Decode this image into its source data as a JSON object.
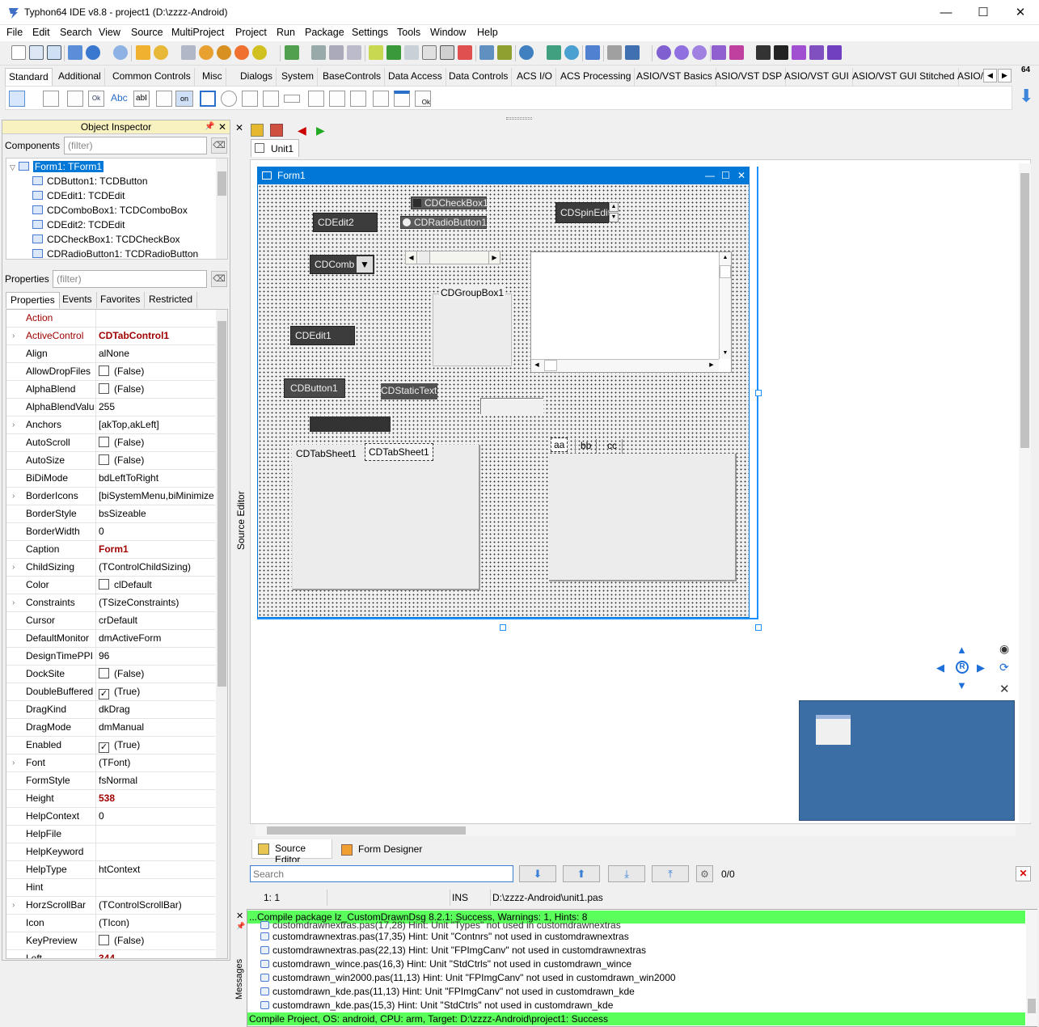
{
  "window": {
    "title": "Typhon64 IDE v8.8 - project1 (D:\\zzzz-Android)",
    "controls": [
      "—",
      "☐",
      "✕"
    ]
  },
  "menu": [
    "File",
    "Edit",
    "Search",
    "View",
    "Source",
    "MultiProject",
    "Project",
    "Run",
    "Package",
    "Settings",
    "Tools",
    "Window",
    "Help"
  ],
  "palette": {
    "tabs": [
      "Standard",
      "Additional",
      "Common Controls",
      "Misc",
      "Dialogs",
      "System",
      "BaseControls",
      "Data Access",
      "Data Controls",
      "ACS I/O",
      "ACS Processing",
      "ASIO/VST Basics",
      "ASIO/VST DSP",
      "ASIO/VST GUI",
      "ASIO/VST GUI Stitched",
      "ASIO/"
    ],
    "active": "Standard",
    "zoom": "64"
  },
  "object_inspector": {
    "title": "Object Inspector",
    "components_label": "Components",
    "filter_placeholder": "(filter)",
    "tree": [
      "Form1: TForm1",
      "CDButton1: TCDButton",
      "CDEdit1: TCDEdit",
      "CDComboBox1: TCDComboBox",
      "CDEdit2: TCDEdit",
      "CDCheckBox1: TCDCheckBox",
      "CDRadioButton1: TCDRadioButton"
    ],
    "properties_label": "Properties",
    "tabs": [
      "Properties",
      "Events",
      "Favorites",
      "Restricted"
    ],
    "rows": [
      {
        "name": "Action",
        "value": ""
      },
      {
        "name": "ActiveControl",
        "value": "CDTabControl1"
      },
      {
        "name": "Align",
        "value": "alNone"
      },
      {
        "name": "AllowDropFiles",
        "value": "(False)"
      },
      {
        "name": "AlphaBlend",
        "value": "(False)"
      },
      {
        "name": "AlphaBlendValu",
        "value": "255"
      },
      {
        "name": "Anchors",
        "value": "[akTop,akLeft]"
      },
      {
        "name": "AutoScroll",
        "value": "(False)"
      },
      {
        "name": "AutoSize",
        "value": "(False)"
      },
      {
        "name": "BiDiMode",
        "value": "bdLeftToRight"
      },
      {
        "name": "BorderIcons",
        "value": "[biSystemMenu,biMinimize"
      },
      {
        "name": "BorderStyle",
        "value": "bsSizeable"
      },
      {
        "name": "BorderWidth",
        "value": "0"
      },
      {
        "name": "Caption",
        "value": "Form1"
      },
      {
        "name": "ChildSizing",
        "value": "(TControlChildSizing)"
      },
      {
        "name": "Color",
        "value": "clDefault"
      },
      {
        "name": "Constraints",
        "value": "(TSizeConstraints)"
      },
      {
        "name": "Cursor",
        "value": "crDefault"
      },
      {
        "name": "DefaultMonitor",
        "value": "dmActiveForm"
      },
      {
        "name": "DesignTimePPI",
        "value": "96"
      },
      {
        "name": "DockSite",
        "value": "(False)"
      },
      {
        "name": "DoubleBuffered",
        "value": "(True)"
      },
      {
        "name": "DragKind",
        "value": "dkDrag"
      },
      {
        "name": "DragMode",
        "value": "dmManual"
      },
      {
        "name": "Enabled",
        "value": "(True)"
      },
      {
        "name": "Font",
        "value": "(TFont)"
      },
      {
        "name": "FormStyle",
        "value": "fsNormal"
      },
      {
        "name": "Height",
        "value": "538"
      },
      {
        "name": "HelpContext",
        "value": "0"
      },
      {
        "name": "HelpFile",
        "value": ""
      },
      {
        "name": "HelpKeyword",
        "value": ""
      },
      {
        "name": "HelpType",
        "value": "htContext"
      },
      {
        "name": "Hint",
        "value": ""
      },
      {
        "name": "HorzScrollBar",
        "value": "(TControlScrollBar)"
      },
      {
        "name": "Icon",
        "value": "(TIcon)"
      },
      {
        "name": "KeyPreview",
        "value": "(False)"
      },
      {
        "name": "Left",
        "value": "344"
      }
    ]
  },
  "source_editor_label": "Source Editor",
  "editor_tab": "Unit1",
  "form": {
    "caption": "Form1",
    "controls": {
      "cdedit2": "CDEdit2",
      "cdcheckbox1": "CDCheckBox1",
      "cdradiobutton1": "CDRadioButton1",
      "cdspinedit": "CDSpinEdit",
      "cdcombo": "CDComb",
      "cdgroupbox1": "CDGroupBox1",
      "cdedit1": "CDEdit1",
      "cdbutton1": "CDButton1",
      "cdstatictext": "CDStaticText",
      "tabsheet1": "CDTabSheet1",
      "tabsheet2": "CDTabSheet1",
      "tab_aa": "aa",
      "tab_bb": "bb",
      "tab_cc": "cc"
    }
  },
  "bottom_tabs": [
    "Source Editor",
    "Form Designer"
  ],
  "search": {
    "placeholder": "Search",
    "count": "0/0"
  },
  "status": {
    "pos": "1:  1",
    "mode": "INS",
    "file": "D:\\zzzz-Android\\unit1.pas"
  },
  "messages": {
    "label": "Messages",
    "header": "...Compile package lz_CustomDrawnDsg 8.2.1: Success, Warnings: 1, Hints: 8",
    "rows": [
      "customdrawnextras.pas(17,28) Hint: Unit \"Types\" not used in customdrawnextras",
      "customdrawnextras.pas(17,35) Hint: Unit \"Contnrs\" not used in customdrawnextras",
      "customdrawnextras.pas(22,13) Hint: Unit \"FPImgCanv\" not used in customdrawnextras",
      "customdrawn_wince.pas(16,3) Hint: Unit \"StdCtrls\" not used in customdrawn_wince",
      "customdrawn_win2000.pas(11,13) Hint: Unit \"FPImgCanv\" not used in customdrawn_win2000",
      "customdrawn_kde.pas(11,13) Hint: Unit \"FPImgCanv\" not used in customdrawn_kde",
      "customdrawn_kde.pas(15,3) Hint: Unit \"StdCtrls\" not used in customdrawn_kde"
    ],
    "footer": "Compile Project, OS: android, CPU: arm, Target: D:\\zzzz-Android\\project1: Success"
  },
  "colors": {
    "accent": "#0078d7",
    "success": "#5bff5b",
    "form_blue": "#3a6ea5"
  }
}
